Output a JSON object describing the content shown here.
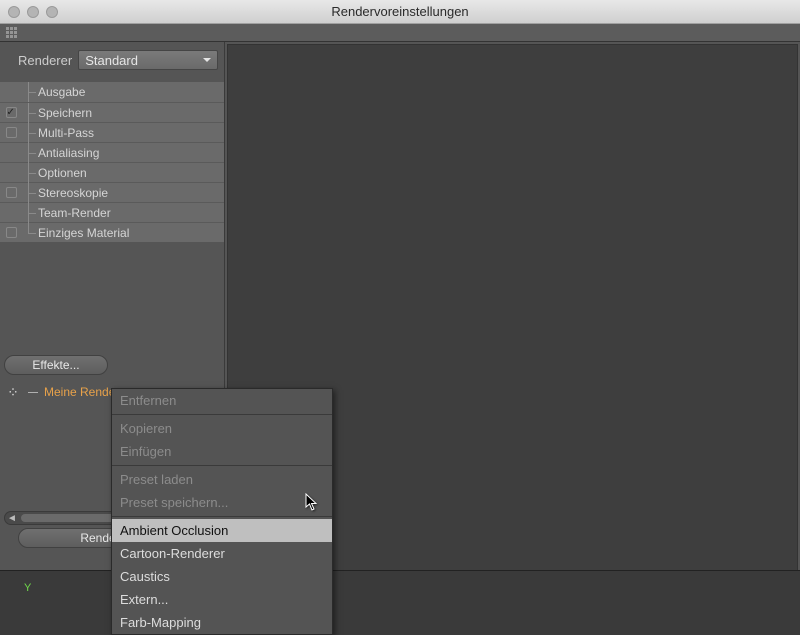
{
  "window": {
    "title": "Rendervoreinstellungen"
  },
  "renderer": {
    "label": "Renderer",
    "selected": "Standard"
  },
  "tree": [
    {
      "label": "Ausgabe",
      "checkbox": null
    },
    {
      "label": "Speichern",
      "checkbox": "checked"
    },
    {
      "label": "Multi-Pass",
      "checkbox": "unchecked"
    },
    {
      "label": "Antialiasing",
      "checkbox": null
    },
    {
      "label": "Optionen",
      "checkbox": null
    },
    {
      "label": "Stereoskopie",
      "checkbox": "unchecked"
    },
    {
      "label": "Team-Render",
      "checkbox": null
    },
    {
      "label": "Einziges Material",
      "checkbox": "unchecked"
    }
  ],
  "effects_button": "Effekte...",
  "preset_row": {
    "label": "Meine Rende"
  },
  "rv_button": "Rendervorei",
  "menu": {
    "items": [
      {
        "label": "Entfernen",
        "disabled": true
      },
      {
        "sep": true
      },
      {
        "label": "Kopieren",
        "disabled": true
      },
      {
        "label": "Einfügen",
        "disabled": true
      },
      {
        "sep": true
      },
      {
        "label": "Preset laden",
        "disabled": true
      },
      {
        "label": "Preset speichern...",
        "disabled": true
      },
      {
        "sep": true
      },
      {
        "label": "Ambient Occlusion",
        "highlight": true
      },
      {
        "label": "Cartoon-Renderer"
      },
      {
        "label": "Caustics"
      },
      {
        "label": "Extern..."
      },
      {
        "label": "Farb-Mapping"
      }
    ]
  },
  "axis": {
    "y": "Y"
  }
}
